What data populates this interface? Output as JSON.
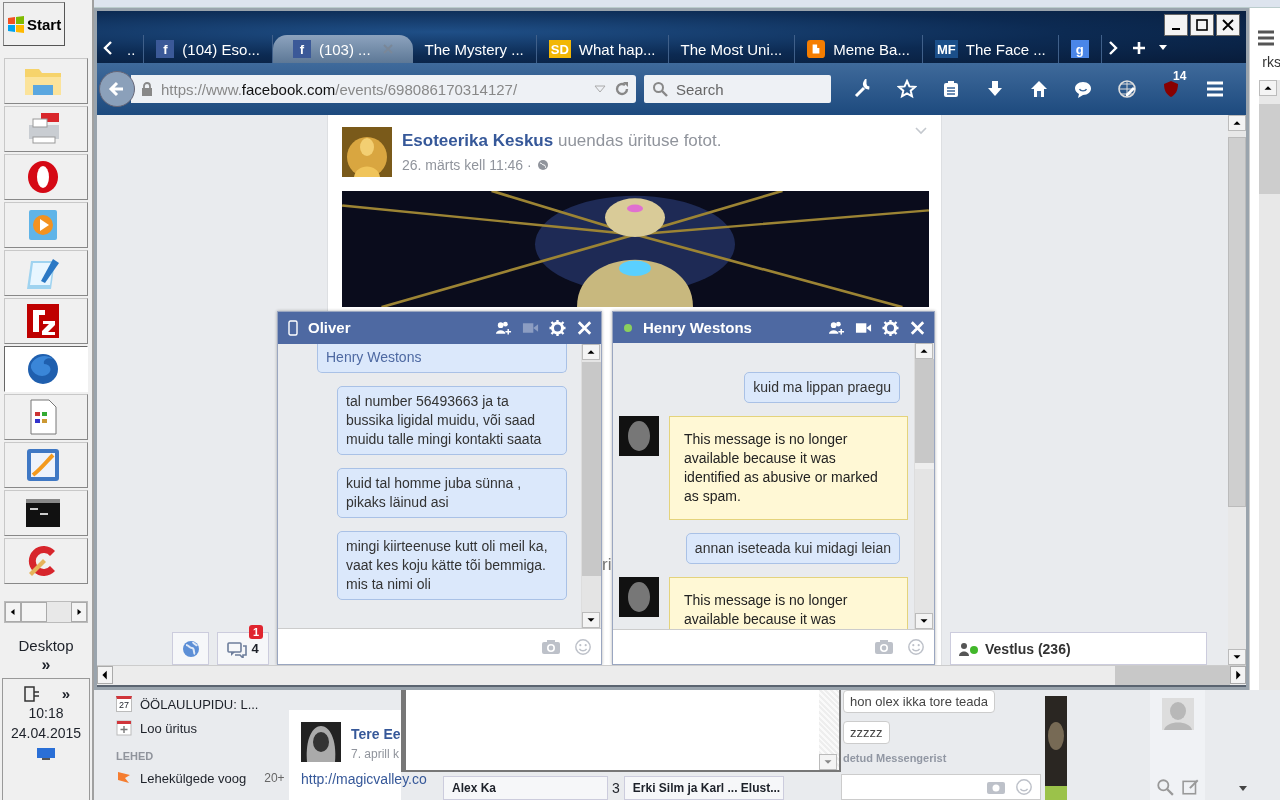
{
  "taskbar": {
    "start": "Start",
    "apps": [
      {
        "kind": "folder",
        "selected": false
      },
      {
        "kind": "printer",
        "selected": false
      },
      {
        "kind": "opera",
        "selected": false
      },
      {
        "kind": "player",
        "selected": false
      },
      {
        "kind": "notepad",
        "selected": false
      },
      {
        "kind": "ftp",
        "selected": false
      },
      {
        "kind": "firefox",
        "selected": true
      },
      {
        "kind": "document",
        "selected": false
      },
      {
        "kind": "editor",
        "selected": false
      },
      {
        "kind": "console",
        "selected": false
      },
      {
        "kind": "cleaner",
        "selected": false
      }
    ],
    "desktop": "Desktop",
    "more": "»",
    "tray_more": "»",
    "time": "10:18",
    "date": "24.04.2015"
  },
  "browser": {
    "overflow_tab": "..",
    "tabs": [
      {
        "label": "(104) Eso...",
        "icon": {
          "text": "f",
          "color": "#3b5998"
        },
        "selected": false
      },
      {
        "label": "(103) ...",
        "icon": {
          "text": "f",
          "color": "#3b5998"
        },
        "selected": true
      },
      {
        "label": "The Mystery ...",
        "selected": false
      },
      {
        "label": "What hap...",
        "icon": {
          "text": "SD",
          "color": "#f2b705"
        },
        "selected": false
      },
      {
        "label": "The Most Uni...",
        "selected": false
      },
      {
        "label": "Meme Ba...",
        "icon": {
          "color": "#f57d00"
        },
        "selected": false
      },
      {
        "label": "The Face ...",
        "icon": {
          "text": "MF",
          "color": "#1b4f8a"
        },
        "selected": false
      },
      {
        "icon": {
          "text": "g",
          "color": "#4a86e8"
        },
        "selected": false
      }
    ],
    "url": {
      "prefix": "https://www.",
      "domain": "facebook.com",
      "path": "/events/698086170314127/"
    },
    "search": {
      "placeholder": "Search"
    },
    "addon_badge": "14"
  },
  "post": {
    "author": "Esoteerika Keskus",
    "action": "uuendas ürituse fotot.",
    "time": "26. märts kell 11:46 ·"
  },
  "chats": [
    {
      "name": "Oliver",
      "kind": "mobile",
      "video": false,
      "messages": [
        {
          "kind": "link",
          "text": "Henry Westons"
        },
        {
          "kind": "sent",
          "text": "tal number 56493663 ja ta bussika ligidal muidu, või saad muidu talle mingi kontakti saata"
        },
        {
          "kind": "sent",
          "text": "kuid tal homme juba sünna , pikaks läinud asi"
        },
        {
          "kind": "sent",
          "text": "mingi kiirteenuse kutt oli meil ka, vaat kes koju kätte tõi bemmiga. mis ta nimi oli"
        }
      ]
    },
    {
      "name": "Henry Westons",
      "kind": "online",
      "video": true,
      "messages": [
        {
          "kind": "sent",
          "text": "kuid ma lippan praegu"
        },
        {
          "kind": "removed",
          "text": "This message is no longer available because it was identified as abusive or marked as spam."
        },
        {
          "kind": "sent",
          "text": "annan iseteada kui midagi leian"
        },
        {
          "kind": "removed",
          "text": "This message is no longer available because it was"
        }
      ]
    }
  ],
  "stray_text": "ri",
  "dock": {
    "chat_badge": "1",
    "chat_count": "4",
    "buddy_list": "Vestlus (236)"
  },
  "side_window": {
    "text": "rks"
  },
  "background_page": {
    "sidebar": [
      {
        "kind": "event",
        "day": "27",
        "label": "ÖÖLAULUPIDU: L..."
      },
      {
        "kind": "create",
        "label": "Loo üritus"
      }
    ],
    "section": "LEHED",
    "feed": {
      "label": "Lehekülgede voog",
      "count": "20+"
    },
    "post": {
      "author": "Tere Ee",
      "time": "7. aprill k",
      "link": "http://magicvalley.co"
    },
    "chat_tabs": [
      {
        "label": "Alex Ka"
      },
      {
        "label": "Erki Silm ja Karl ... Elust..."
      }
    ],
    "tab_gap_text": "3",
    "chat_fragments": [
      "hon olex ikka tore teada",
      "zzzzz"
    ],
    "chat_note": "detud Messengerist"
  }
}
